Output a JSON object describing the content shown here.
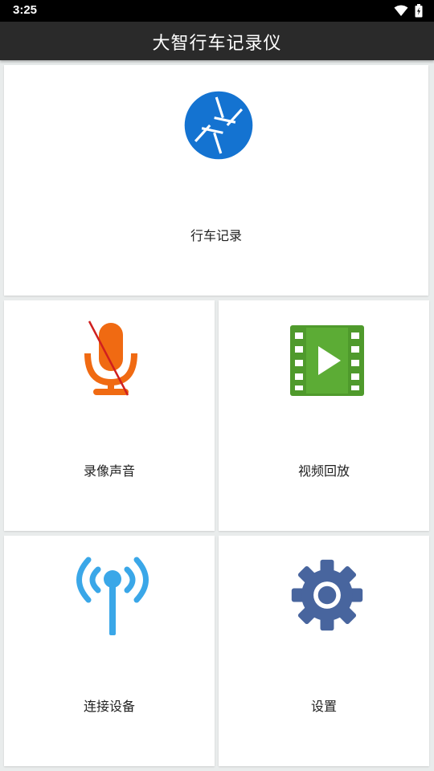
{
  "status_bar": {
    "time": "3:25"
  },
  "app_bar": {
    "title": "大智行车记录仪"
  },
  "tiles": [
    {
      "label": "行车记录",
      "icon": "camera-shutter-icon",
      "color": "#1473d1"
    },
    {
      "label": "录像声音",
      "icon": "microphone-muted-icon",
      "color": "#f06a12"
    },
    {
      "label": "视频回放",
      "icon": "video-playback-icon",
      "color": "#4f9a2c"
    },
    {
      "label": "连接设备",
      "icon": "antenna-signal-icon",
      "color": "#3aa7e8"
    },
    {
      "label": "设置",
      "icon": "gear-icon",
      "color": "#48659e"
    }
  ]
}
